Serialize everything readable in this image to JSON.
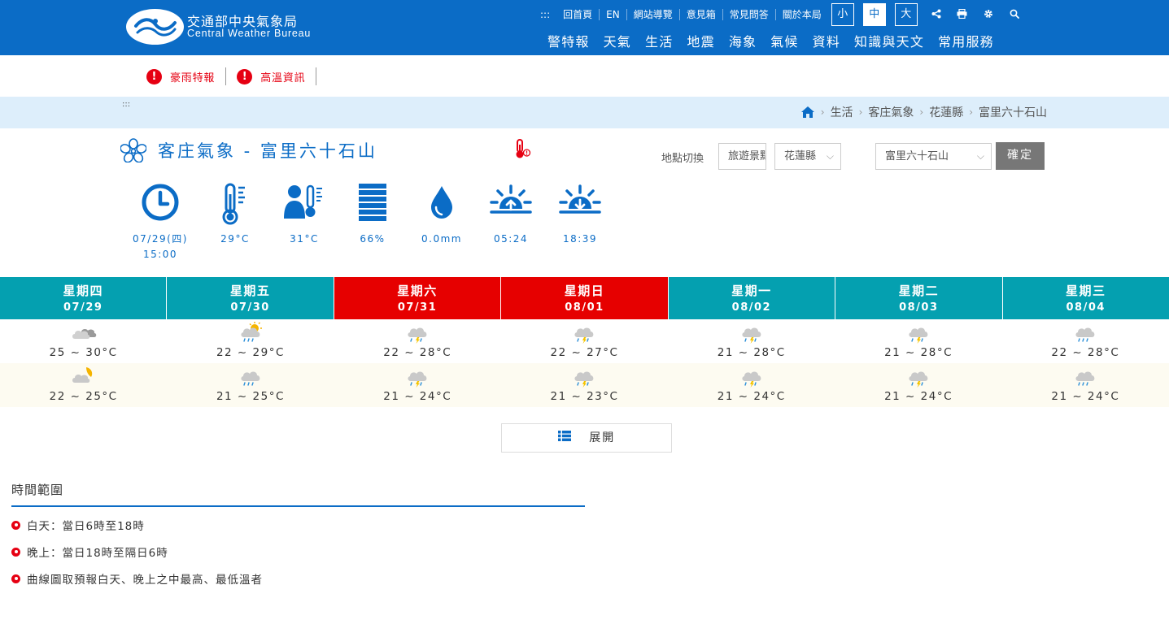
{
  "header": {
    "logo_cn": "交通部中央氣象局",
    "logo_en": "Central Weather Bureau",
    "top_links": [
      ":::",
      "回首頁",
      "EN",
      "網站導覽",
      "意見箱",
      "常見問答",
      "關於本局"
    ],
    "font_sizes": [
      "小",
      "中",
      "大"
    ],
    "font_size_selected": "中",
    "tool_icons": [
      "share-icon",
      "print-icon",
      "gear-icon",
      "search-icon"
    ],
    "main_nav": [
      "警特報",
      "天氣",
      "生活",
      "地震",
      "海象",
      "氣候",
      "資料",
      "知識與天文",
      "常用服務"
    ]
  },
  "alerts": [
    {
      "icon": "!",
      "text": "豪雨特報"
    },
    {
      "icon": "!",
      "text": "高溫資訊"
    }
  ],
  "breadcrumb": {
    "accesskey": ":::",
    "items": [
      "生活",
      "客庄氣象",
      "花蓮縣",
      "富里六十石山"
    ]
  },
  "title": "客庄氣象 - 富里六十石山",
  "location": {
    "label": "地點切換",
    "select1": "旅遊景點",
    "select2": "花蓮縣",
    "select3": "富里六十石山",
    "confirm": "確定"
  },
  "observation": {
    "datetime_line1": "07/29(四)",
    "datetime_line2": "15:00",
    "temperature": "29°C",
    "apparent_temperature": "31°C",
    "humidity": "66%",
    "rainfall": "0.0mm",
    "sunrise": "05:24",
    "sunset": "18:39"
  },
  "forecast": {
    "days": [
      {
        "weekday": "星期四",
        "date": "07/29",
        "weekend": false,
        "day_icon": "cloudy-icon",
        "day_temp": "25 ~ 30°C",
        "night_icon": "partly-cloudy-night-icon",
        "night_temp": "22 ~ 25°C"
      },
      {
        "weekday": "星期五",
        "date": "07/30",
        "weekend": false,
        "day_icon": "sunny-shower-icon",
        "day_temp": "22 ~ 29°C",
        "night_icon": "shower-icon",
        "night_temp": "21 ~ 25°C"
      },
      {
        "weekday": "星期六",
        "date": "07/31",
        "weekend": true,
        "day_icon": "thunderstorm-icon",
        "day_temp": "22 ~ 28°C",
        "night_icon": "thunderstorm-icon",
        "night_temp": "21 ~ 24°C"
      },
      {
        "weekday": "星期日",
        "date": "08/01",
        "weekend": true,
        "day_icon": "thunderstorm-icon",
        "day_temp": "22 ~ 27°C",
        "night_icon": "thunderstorm-icon",
        "night_temp": "21 ~ 23°C"
      },
      {
        "weekday": "星期一",
        "date": "08/02",
        "weekend": false,
        "day_icon": "thunderstorm-icon",
        "day_temp": "21 ~ 28°C",
        "night_icon": "thunderstorm-icon",
        "night_temp": "21 ~ 24°C"
      },
      {
        "weekday": "星期二",
        "date": "08/03",
        "weekend": false,
        "day_icon": "thunderstorm-icon",
        "day_temp": "21 ~ 28°C",
        "night_icon": "thunderstorm-icon",
        "night_temp": "21 ~ 24°C"
      },
      {
        "weekday": "星期三",
        "date": "08/04",
        "weekend": false,
        "day_icon": "shower-icon",
        "day_temp": "22 ~ 28°C",
        "night_icon": "shower-icon",
        "night_temp": "21 ~ 24°C"
      }
    ]
  },
  "expand_label": "展開",
  "time_range": {
    "title": "時間範圍",
    "items": [
      "白天：當日6時至18時",
      "晚上：當日18時至隔日6時",
      "曲線圖取預報白天、晚上之中最高、最低溫者"
    ]
  },
  "colors": {
    "brand_blue": "#0b6cc6",
    "teal": "#04a0b0",
    "weekend_red": "#e60000",
    "alert_red": "#e60012"
  }
}
